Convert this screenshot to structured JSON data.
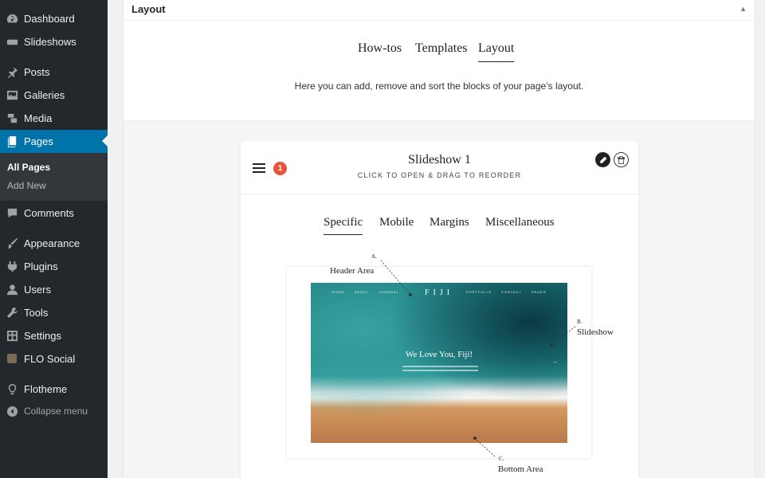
{
  "sidebar": {
    "items": [
      {
        "label": "Dashboard",
        "icon": "dashboard-icon"
      },
      {
        "label": "Slideshows",
        "icon": "slideshow-icon"
      },
      {
        "label": "Posts",
        "icon": "pin-icon"
      },
      {
        "label": "Galleries",
        "icon": "gallery-icon"
      },
      {
        "label": "Media",
        "icon": "media-icon"
      },
      {
        "label": "Pages",
        "icon": "page-icon"
      },
      {
        "label": "Comments",
        "icon": "comment-icon"
      },
      {
        "label": "Appearance",
        "icon": "brush-icon"
      },
      {
        "label": "Plugins",
        "icon": "plugin-icon"
      },
      {
        "label": "Users",
        "icon": "user-icon"
      },
      {
        "label": "Tools",
        "icon": "wrench-icon"
      },
      {
        "label": "Settings",
        "icon": "settings-icon"
      },
      {
        "label": "FLO Social",
        "icon": "flo-social-icon"
      },
      {
        "label": "Flotheme",
        "icon": "bulb-icon"
      }
    ],
    "submenu": [
      "All Pages",
      "Add New"
    ],
    "collapse_label": "Collapse menu"
  },
  "panel": {
    "title": "Layout",
    "tabs": [
      "How-tos",
      "Templates",
      "Layout"
    ],
    "intro": "Here you can add, remove and sort the blocks of your page’s layout."
  },
  "card": {
    "badge": "1",
    "title": "Slideshow 1",
    "subtitle": "CLICK TO OPEN & DRAG TO REORDER",
    "tabs": [
      "Specific",
      "Mobile",
      "Margins",
      "Miscellaneous"
    ]
  },
  "preview": {
    "logo": "FIJI",
    "nav_left": [
      "HOME",
      "ABOUT",
      "JOURNAL"
    ],
    "nav_right": [
      "PORTFOLIO",
      "CONTACT",
      "PAGES"
    ],
    "headline": "We Love You, Fiji!",
    "annotations": {
      "a_letter": "A.",
      "a_label": "Header Area",
      "b_letter": "B.",
      "b_label": "Slideshow",
      "c_letter": "C.",
      "c_label": "Bottom Area"
    }
  },
  "colors": {
    "sidebar_bg": "#23282d",
    "active_menu": "#0073aa",
    "badge": "#e8553a"
  }
}
